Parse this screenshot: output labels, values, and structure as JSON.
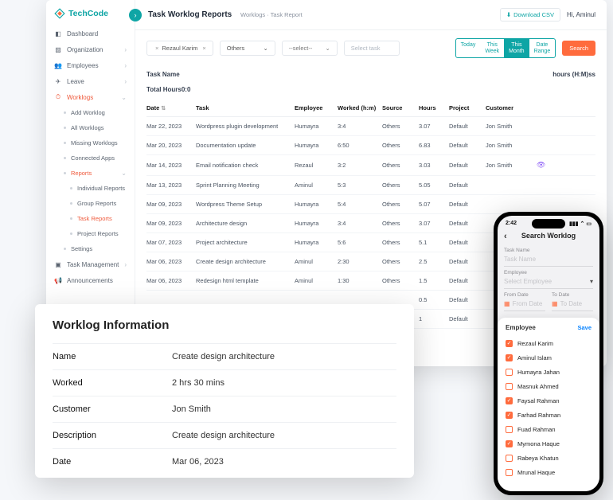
{
  "brand": "TechCode",
  "topbar": {
    "title": "Task Worklog Reports",
    "crumb1": "Worklogs",
    "sep": "·",
    "crumb2": "Task Report",
    "download": "Download CSV",
    "greeting": "Hi, Aminul"
  },
  "sidebar": {
    "items": [
      {
        "label": "Dashboard"
      },
      {
        "label": "Organization",
        "chev": "›"
      },
      {
        "label": "Employees",
        "chev": "›"
      },
      {
        "label": "Leave",
        "chev": "›"
      },
      {
        "label": "Worklogs",
        "chev": "⌄",
        "active": true
      },
      {
        "label": "Add Worklog",
        "sub": true
      },
      {
        "label": "All Worklogs",
        "sub": true
      },
      {
        "label": "Missing Worklogs",
        "sub": true
      },
      {
        "label": "Connected Apps",
        "sub": true
      },
      {
        "label": "Reports",
        "sub": true,
        "chev": "⌄",
        "active": true
      },
      {
        "label": "Individual Reports",
        "sub2": true
      },
      {
        "label": "Group Reports",
        "sub2": true
      },
      {
        "label": "Task Reports",
        "sub2": true,
        "active": true
      },
      {
        "label": "Project Reports",
        "sub2": true
      },
      {
        "label": "Settings",
        "sub": true
      },
      {
        "label": "Task Management",
        "chev": "›"
      },
      {
        "label": "Announcements"
      }
    ]
  },
  "filters": {
    "employee": "Rezaul Karim",
    "type": "Others",
    "sel": "--select--",
    "task_ph": "Select task",
    "range": [
      "Today",
      "This Week",
      "This Month",
      "Date Range"
    ],
    "active_range": "This Month",
    "search": "Search"
  },
  "table": {
    "h1": "Task Name",
    "h2": "hours (H:M)ss",
    "total_lbl": "Total Hours",
    "total_val": "0:0",
    "cols": [
      "Date",
      "Task",
      "Employee",
      "Worked (h:m)",
      "Source",
      "Hours",
      "Project",
      "Customer"
    ],
    "rows": [
      {
        "date": "Mar 22, 2023",
        "task": "Wordpress plugin development",
        "emp": "Humayra",
        "worked": "3:4",
        "src": "Others",
        "hrs": "3.07",
        "proj": "Default",
        "cust": "Jon Smith"
      },
      {
        "date": "Mar 20, 2023",
        "task": "Documentation update",
        "emp": "Humayra",
        "worked": "6:50",
        "src": "Others",
        "hrs": "6.83",
        "proj": "Default",
        "cust": "Jon Smith"
      },
      {
        "date": "Mar 14, 2023",
        "task": "Email notification check",
        "emp": "Rezaul",
        "worked": "3:2",
        "src": "Others",
        "hrs": "3.03",
        "proj": "Default",
        "cust": "Jon Smith",
        "eye": true
      },
      {
        "date": "Mar 13, 2023",
        "task": "Sprint Planning Meeting",
        "emp": "Aminul",
        "worked": "5:3",
        "src": "Others",
        "hrs": "5.05",
        "proj": "Default",
        "cust": ""
      },
      {
        "date": "Mar 09, 2023",
        "task": "Wordpress Theme Setup",
        "emp": "Humayra",
        "worked": "5:4",
        "src": "Others",
        "hrs": "5.07",
        "proj": "Default",
        "cust": ""
      },
      {
        "date": "Mar 09, 2023",
        "task": "Architecture design",
        "emp": "Humayra",
        "worked": "3:4",
        "src": "Others",
        "hrs": "3.07",
        "proj": "Default",
        "cust": ""
      },
      {
        "date": "Mar 07, 2023",
        "task": "Project architecture",
        "emp": "Humayra",
        "worked": "5:6",
        "src": "Others",
        "hrs": "5.1",
        "proj": "Default",
        "cust": ""
      },
      {
        "date": "Mar 06, 2023",
        "task": "Create design architecture",
        "emp": "Aminul",
        "worked": "2:30",
        "src": "Others",
        "hrs": "2.5",
        "proj": "Default",
        "cust": ""
      },
      {
        "date": "Mar 06, 2023",
        "task": "Redesign html template",
        "emp": "Aminul",
        "worked": "1:30",
        "src": "Others",
        "hrs": "1.5",
        "proj": "Default",
        "cust": ""
      },
      {
        "date": "",
        "task": "",
        "emp": "",
        "worked": "",
        "src": "",
        "hrs": "0.5",
        "proj": "Default",
        "cust": ""
      },
      {
        "date": "",
        "task": "",
        "emp": "",
        "worked": "",
        "src": "",
        "hrs": "1",
        "proj": "Default",
        "cust": ""
      }
    ]
  },
  "info": {
    "title": "Worklog Information",
    "rows": [
      {
        "lbl": "Name",
        "val": "Create design architecture"
      },
      {
        "lbl": "Worked",
        "val": "2 hrs 30 mins"
      },
      {
        "lbl": "Customer",
        "val": "Jon Smith"
      },
      {
        "lbl": "Description",
        "val": "Create design architecture"
      },
      {
        "lbl": "Date",
        "val": "Mar 06, 2023"
      }
    ]
  },
  "phone": {
    "time": "2:42",
    "title": "Search Worklog",
    "task_lbl": "Task Name",
    "task_ph": "Task Name",
    "emp_lbl": "Employee",
    "emp_ph": "Select Employee",
    "from_lbl": "From Date",
    "from_ph": "From Date",
    "to_lbl": "To Date",
    "to_ph": "To Date",
    "sheet_title": "Employee",
    "save": "Save",
    "employees": [
      {
        "name": "Rezaul Karim",
        "on": true
      },
      {
        "name": "Aminul Islam",
        "on": true
      },
      {
        "name": "Humayra Jahan",
        "on": false
      },
      {
        "name": "Masnuk Ahmed",
        "on": false
      },
      {
        "name": "Faysal Rahman",
        "on": true
      },
      {
        "name": "Farhad Rahman",
        "on": true
      },
      {
        "name": "Fuad Rahman",
        "on": false
      },
      {
        "name": "Mymona Haque",
        "on": true
      },
      {
        "name": "Rabeya Khatun",
        "on": false
      },
      {
        "name": "Mrunal Haque",
        "on": false
      }
    ]
  }
}
